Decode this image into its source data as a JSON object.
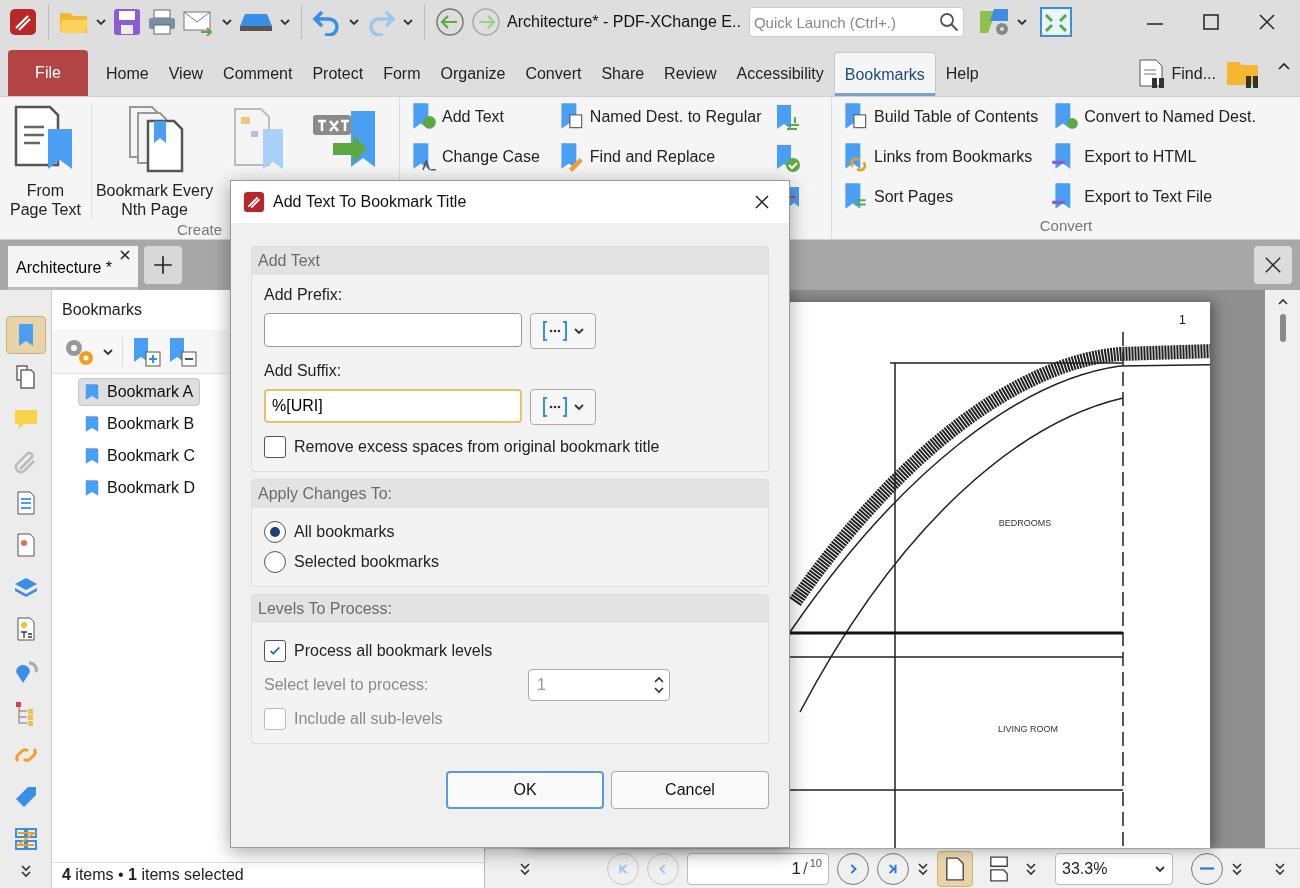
{
  "title_bar": {
    "title": "Architecture* - PDF-XChange E..",
    "quick_launch": {
      "placeholder": "Quick Launch (Ctrl+.)"
    }
  },
  "menu_tabs": [
    {
      "label": "File",
      "kind": "file",
      "selected": false
    },
    {
      "label": "Home",
      "kind": "tab",
      "selected": false
    },
    {
      "label": "View",
      "kind": "tab",
      "selected": false
    },
    {
      "label": "Comment",
      "kind": "tab",
      "selected": false
    },
    {
      "label": "Protect",
      "kind": "tab",
      "selected": false
    },
    {
      "label": "Form",
      "kind": "tab",
      "selected": false
    },
    {
      "label": "Organize",
      "kind": "tab",
      "selected": false
    },
    {
      "label": "Convert",
      "kind": "tab",
      "selected": false
    },
    {
      "label": "Share",
      "kind": "tab",
      "selected": false
    },
    {
      "label": "Review",
      "kind": "tab",
      "selected": false
    },
    {
      "label": "Accessibility",
      "kind": "tab",
      "selected": false
    },
    {
      "label": "Bookmarks",
      "kind": "tab",
      "selected": true
    },
    {
      "label": "Help",
      "kind": "tab",
      "selected": false
    }
  ],
  "find_button": {
    "label": "Find..."
  },
  "ribbon": {
    "create_group": {
      "label": "Create",
      "buttons": [
        {
          "kind": "page-text",
          "label": "From\nPage Text"
        },
        {
          "kind": "every-nth",
          "label": "Bookmark Every\nNth Page"
        },
        {
          "kind": "tree"
        },
        {
          "kind": "txt"
        }
      ]
    },
    "edit_group": {
      "columns": [
        [
          {
            "kind": "add-text",
            "label": "Add Text"
          },
          {
            "kind": "change-case",
            "label": "Change Case"
          }
        ],
        [
          {
            "kind": "named-dest",
            "label": "Named Dest. to Regular"
          },
          {
            "kind": "find-replace",
            "label": "Find and Replace"
          }
        ]
      ]
    },
    "convert_group": {
      "label": "Convert",
      "columns": [
        [
          {
            "kind": "toc",
            "label": "Build Table of Contents"
          },
          {
            "kind": "links",
            "label": "Links from Bookmarks"
          },
          {
            "kind": "sort",
            "label": "Sort Pages"
          }
        ],
        [
          {
            "kind": "to-named",
            "label": "Convert to Named Dest."
          },
          {
            "kind": "html",
            "label": "Export to HTML"
          },
          {
            "kind": "txtfile",
            "label": "Export to Text File"
          }
        ]
      ]
    }
  },
  "document_tabs": [
    {
      "label": "Architecture *",
      "selected": true
    }
  ],
  "sidebar_tools": [
    {
      "kind": "bookmarks",
      "selected": true
    },
    {
      "kind": "pages",
      "selected": false
    },
    {
      "kind": "comments",
      "selected": false
    },
    {
      "kind": "attachments",
      "selected": false
    },
    {
      "kind": "form",
      "selected": false
    },
    {
      "kind": "signature",
      "selected": false
    },
    {
      "kind": "layers",
      "selected": false
    },
    {
      "kind": "content",
      "selected": false
    },
    {
      "kind": "destinations",
      "selected": false
    },
    {
      "kind": "structure",
      "selected": false
    },
    {
      "kind": "links",
      "selected": false
    },
    {
      "kind": "tags",
      "selected": false
    },
    {
      "kind": "articles",
      "selected": false
    }
  ],
  "bookmarks_panel": {
    "title": "Bookmarks",
    "items": [
      {
        "label": "Bookmark A",
        "selected": true
      },
      {
        "label": "Bookmark B",
        "selected": false
      },
      {
        "label": "Bookmark C",
        "selected": false
      },
      {
        "label": "Bookmark D",
        "selected": false
      }
    ],
    "status": "**4** items • **1** items selected"
  },
  "page": {
    "number": "1",
    "rooms": [
      "BEDROOMS",
      "LIVING ROOM"
    ]
  },
  "page_nav": {
    "buttons": [
      {
        "kind": "first",
        "disabled": true
      },
      {
        "kind": "prev",
        "disabled": true
      },
      {
        "kind": "next",
        "disabled": false
      },
      {
        "kind": "last",
        "disabled": false
      }
    ],
    "current": "1",
    "separator": "/",
    "total": "10"
  },
  "view_modes": [
    {
      "kind": "single",
      "selected": true
    },
    {
      "kind": "continuous",
      "selected": false
    }
  ],
  "zoom": "33.3%",
  "dialog": {
    "title": "Add Text To Bookmark Title",
    "add_text": {
      "heading": "Add Text",
      "prefix_label": "Add Prefix:",
      "suffix_label": "Add Suffix:",
      "suffix_value": "%[URI]",
      "remove_spaces": {
        "label": "Remove excess spaces from original bookmark title",
        "checked": false
      }
    },
    "apply_to": {
      "heading": "Apply Changes To:",
      "options": [
        {
          "label": "All bookmarks",
          "selected": true
        },
        {
          "label": "Selected bookmarks",
          "selected": false
        }
      ]
    },
    "levels": {
      "heading": "Levels To Process:",
      "process_all": {
        "label": "Process all bookmark levels",
        "checked": true
      },
      "level_label": "Select level to process:",
      "level_value": "1",
      "disabled": true,
      "sub_levels": {
        "label": "Include all sub-levels",
        "checked": false
      }
    },
    "buttons": [
      {
        "label": "OK",
        "kind": "default"
      },
      {
        "label": "Cancel",
        "kind": "normal"
      }
    ]
  }
}
